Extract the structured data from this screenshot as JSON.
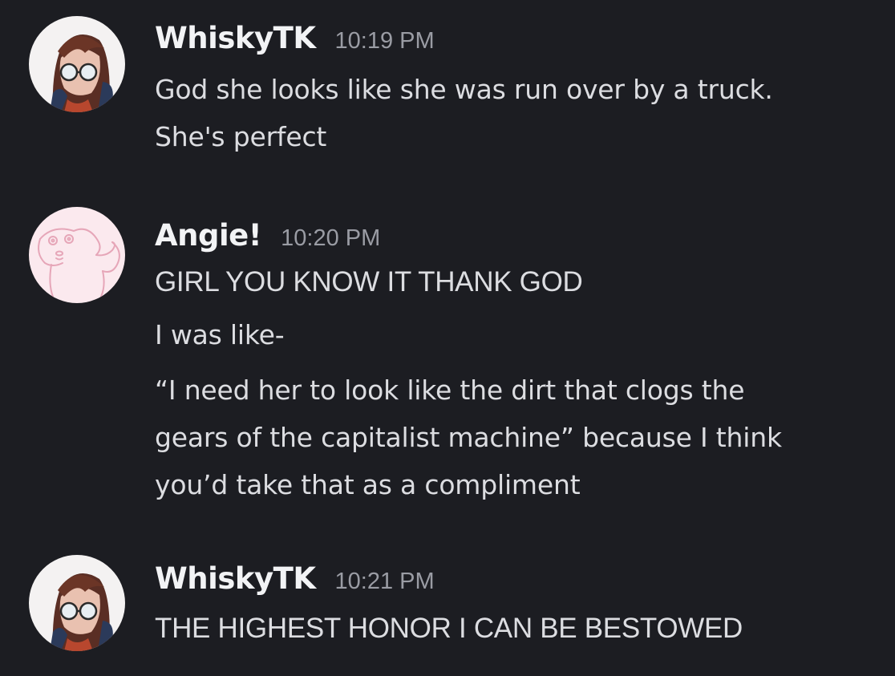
{
  "messages": [
    {
      "username": "WhiskyTK",
      "timestamp": "10:19 PM",
      "avatar_icon": "anime-girl-glasses-avatar",
      "lines": [
        "God she looks like she was run over by a truck.",
        "She's perfect"
      ]
    },
    {
      "username": "Angie!",
      "timestamp": "10:20 PM",
      "avatar_icon": "pink-doodle-creature-avatar",
      "lines": [
        "GIRL YOU KNOW IT THANK GOD",
        "I was like-",
        "“I need her to look like the dirt that clogs the",
        "gears of the capitalist machine” because I think",
        "you’d take that as a compliment"
      ]
    },
    {
      "username": "WhiskyTK",
      "timestamp": "10:21 PM",
      "avatar_icon": "anime-girl-glasses-avatar",
      "lines": [
        "THE HIGHEST HONOR I CAN BE BESTOWED"
      ]
    }
  ],
  "colors": {
    "background": "#1c1d22",
    "username": "#f2f3f5",
    "timestamp": "#9a9ca4",
    "message_text": "#dcdde1"
  }
}
